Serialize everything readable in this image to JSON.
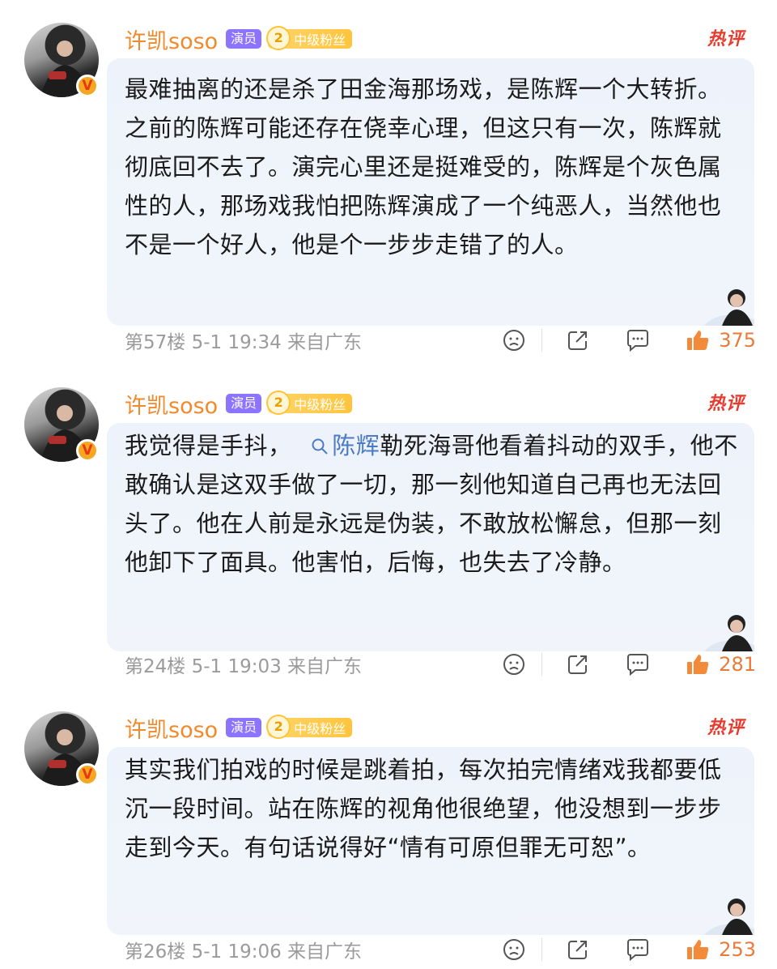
{
  "comments": [
    {
      "username": "许凯soso",
      "role_tag": "演员",
      "fan_level": "2",
      "fan_label": "中级粉丝",
      "hot_label": "热评",
      "text": "最难抽离的还是杀了田金海那场戏，是陈辉一个大转折。之前的陈辉可能还存在侥幸心理，但这只有一次，陈辉就彻底回不去了。演完心里还是挺难受的，陈辉是个灰色属性的人，那场戏我怕把陈辉演成了一个纯恶人，当然他也不是一个好人，他是个一步步走错了的人。",
      "floor_time_location": "第57楼 5-1 19:34 来自广东",
      "likes": "375"
    },
    {
      "username": "许凯soso",
      "role_tag": "演员",
      "fan_level": "2",
      "fan_label": "中级粉丝",
      "hot_label": "热评",
      "text_before": "我觉得是手抖，",
      "hashtag": "陈辉",
      "text_after": "勒死海哥他看着抖动的双手，他不敢确认是这双手做了一切，那一刻他知道自己再也无法回头了。他在人前是永远是伪装，不敢放松懈怠，但那一刻他卸下了面具。他害怕，后悔，也失去了冷静。",
      "floor_time_location": "第24楼 5-1 19:03 来自广东",
      "likes": "281"
    },
    {
      "username": "许凯soso",
      "role_tag": "演员",
      "fan_level": "2",
      "fan_label": "中级粉丝",
      "hot_label": "热评",
      "text": "其实我们拍戏的时候是跳着拍，每次拍完情绪戏我都要低沉一段时间。站在陈辉的视角他很绝望，他没想到一步步走到今天。有句话说得好“情有可原但罪无可恕”。",
      "floor_time_location": "第26楼 5-1 19:06 来自广东",
      "likes": "253"
    }
  ],
  "icons": [
    "verified-icon",
    "dislike-face-icon",
    "share-icon",
    "comment-icon",
    "thumbs-up-icon",
    "search-icon"
  ],
  "colors": {
    "username": "#f08a2c",
    "actor_tag": "#8d74ff",
    "fan_badge": "#ffc43c",
    "hot": "#ea3a2e",
    "bubble": "#eef3fb",
    "hashtag": "#4a7bc4",
    "like": "#ea7a3a",
    "meta": "#9b9b9b"
  }
}
